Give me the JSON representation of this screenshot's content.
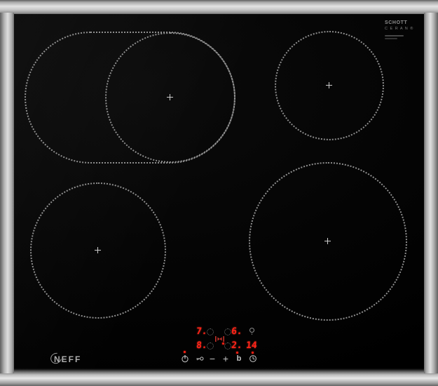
{
  "branding": {
    "logo_text": "NEFF",
    "glass_logo_line1": "SCHOTT",
    "glass_logo_line2": "C E R A N ®"
  },
  "display": {
    "rear_left_level": "7.",
    "rear_right_level": "6.",
    "front_left_level": "8.",
    "front_right_level": "2.",
    "timer_minutes": "14"
  },
  "controls": {
    "minus_label": "−",
    "plus_label": "+",
    "timer_label": "b"
  },
  "icons": {
    "power": "power-standby-icon",
    "child_lock": "key-icon",
    "clock": "clock-timer-icon",
    "lamp": "indicator-lamp-icon",
    "bridge": "move-pan-indicator-icon"
  },
  "zones": [
    {
      "name": "rear-left-flex-oval"
    },
    {
      "name": "rear-left-circle"
    },
    {
      "name": "rear-right"
    },
    {
      "name": "front-left"
    },
    {
      "name": "front-right"
    }
  ],
  "colors": {
    "led_red": "#ff2318",
    "icon_grey": "#c4c4c4",
    "zone_dot_grey": "#8e8e8e",
    "frame_steel": "#c2c2c2",
    "glass_black": "#050505"
  }
}
